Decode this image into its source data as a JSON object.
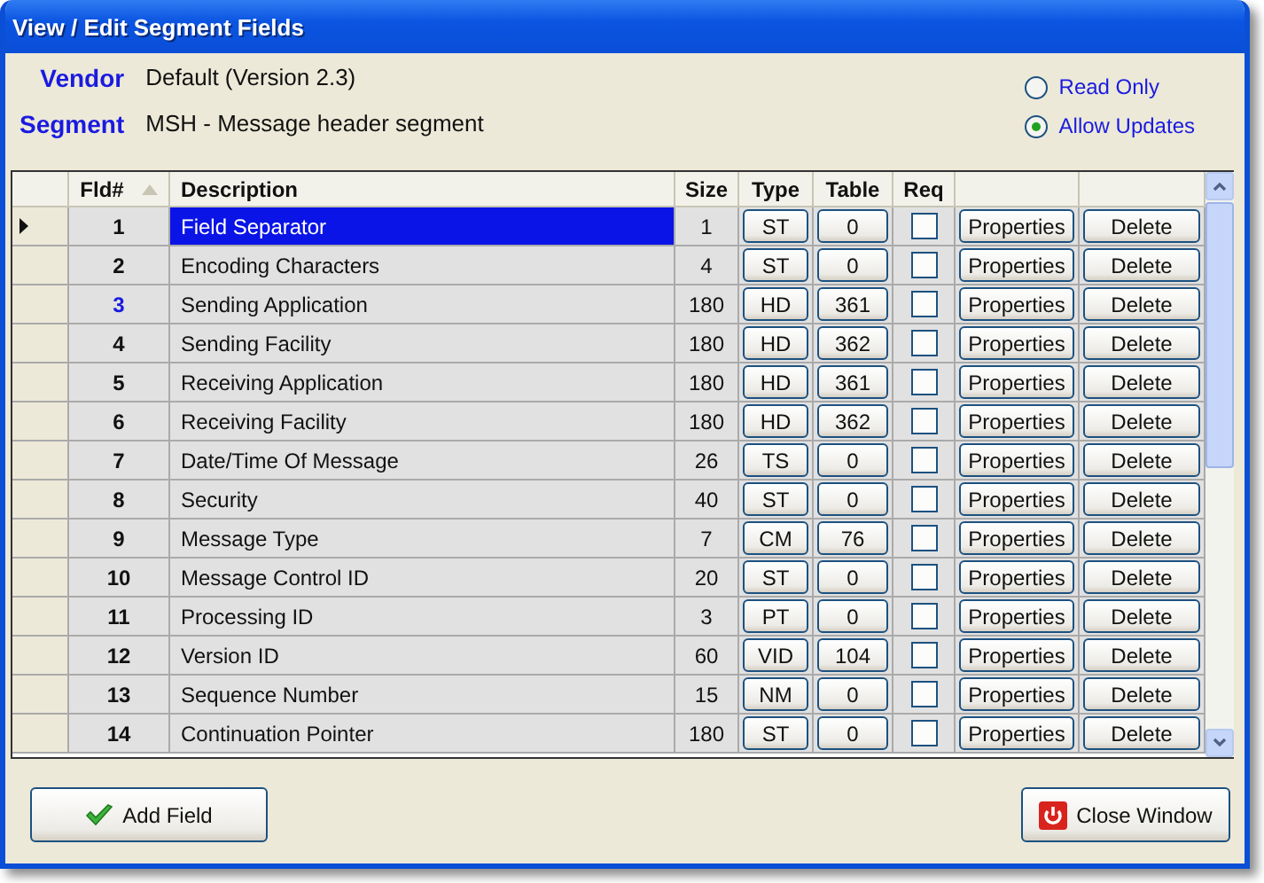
{
  "window": {
    "title": "View / Edit Segment Fields"
  },
  "info": [
    {
      "label": "Vendor",
      "value": "Default (Version 2.3)"
    },
    {
      "label": "Segment",
      "value": "MSH - Message header segment"
    }
  ],
  "mode_options": [
    {
      "label": "Read Only",
      "selected": false
    },
    {
      "label": "Allow Updates",
      "selected": true
    }
  ],
  "table": {
    "columns": [
      "Fld#",
      "Description",
      "Size",
      "Type",
      "Table",
      "Req"
    ],
    "rows": [
      {
        "fld": "1",
        "description": "Field Separator",
        "size": "1",
        "type": "ST",
        "table": "0",
        "required": false,
        "selected": true,
        "highlighted": false,
        "properties": "Properties",
        "delete": "Delete"
      },
      {
        "fld": "2",
        "description": "Encoding Characters",
        "size": "4",
        "type": "ST",
        "table": "0",
        "required": false,
        "selected": false,
        "highlighted": false,
        "properties": "Properties",
        "delete": "Delete"
      },
      {
        "fld": "3",
        "description": "Sending Application",
        "size": "180",
        "type": "HD",
        "table": "361",
        "required": false,
        "selected": false,
        "highlighted": true,
        "properties": "Properties",
        "delete": "Delete"
      },
      {
        "fld": "4",
        "description": "Sending Facility",
        "size": "180",
        "type": "HD",
        "table": "362",
        "required": false,
        "selected": false,
        "highlighted": false,
        "properties": "Properties",
        "delete": "Delete"
      },
      {
        "fld": "5",
        "description": "Receiving Application",
        "size": "180",
        "type": "HD",
        "table": "361",
        "required": false,
        "selected": false,
        "highlighted": false,
        "properties": "Properties",
        "delete": "Delete"
      },
      {
        "fld": "6",
        "description": "Receiving Facility",
        "size": "180",
        "type": "HD",
        "table": "362",
        "required": false,
        "selected": false,
        "highlighted": false,
        "properties": "Properties",
        "delete": "Delete"
      },
      {
        "fld": "7",
        "description": "Date/Time Of Message",
        "size": "26",
        "type": "TS",
        "table": "0",
        "required": false,
        "selected": false,
        "highlighted": false,
        "properties": "Properties",
        "delete": "Delete"
      },
      {
        "fld": "8",
        "description": "Security",
        "size": "40",
        "type": "ST",
        "table": "0",
        "required": false,
        "selected": false,
        "highlighted": false,
        "properties": "Properties",
        "delete": "Delete"
      },
      {
        "fld": "9",
        "description": "Message Type",
        "size": "7",
        "type": "CM",
        "table": "76",
        "required": false,
        "selected": false,
        "highlighted": false,
        "properties": "Properties",
        "delete": "Delete"
      },
      {
        "fld": "10",
        "description": "Message Control ID",
        "size": "20",
        "type": "ST",
        "table": "0",
        "required": false,
        "selected": false,
        "highlighted": false,
        "properties": "Properties",
        "delete": "Delete"
      },
      {
        "fld": "11",
        "description": "Processing ID",
        "size": "3",
        "type": "PT",
        "table": "0",
        "required": false,
        "selected": false,
        "highlighted": false,
        "properties": "Properties",
        "delete": "Delete"
      },
      {
        "fld": "12",
        "description": "Version ID",
        "size": "60",
        "type": "VID",
        "table": "104",
        "required": false,
        "selected": false,
        "highlighted": false,
        "properties": "Properties",
        "delete": "Delete"
      },
      {
        "fld": "13",
        "description": "Sequence Number",
        "size": "15",
        "type": "NM",
        "table": "0",
        "required": false,
        "selected": false,
        "highlighted": false,
        "properties": "Properties",
        "delete": "Delete"
      },
      {
        "fld": "14",
        "description": "Continuation Pointer",
        "size": "180",
        "type": "ST",
        "table": "0",
        "required": false,
        "selected": false,
        "highlighted": false,
        "properties": "Properties",
        "delete": "Delete"
      }
    ]
  },
  "buttons": [
    {
      "label": "Add Field",
      "kind": "add"
    },
    {
      "label": "Close Window",
      "kind": "close"
    }
  ]
}
